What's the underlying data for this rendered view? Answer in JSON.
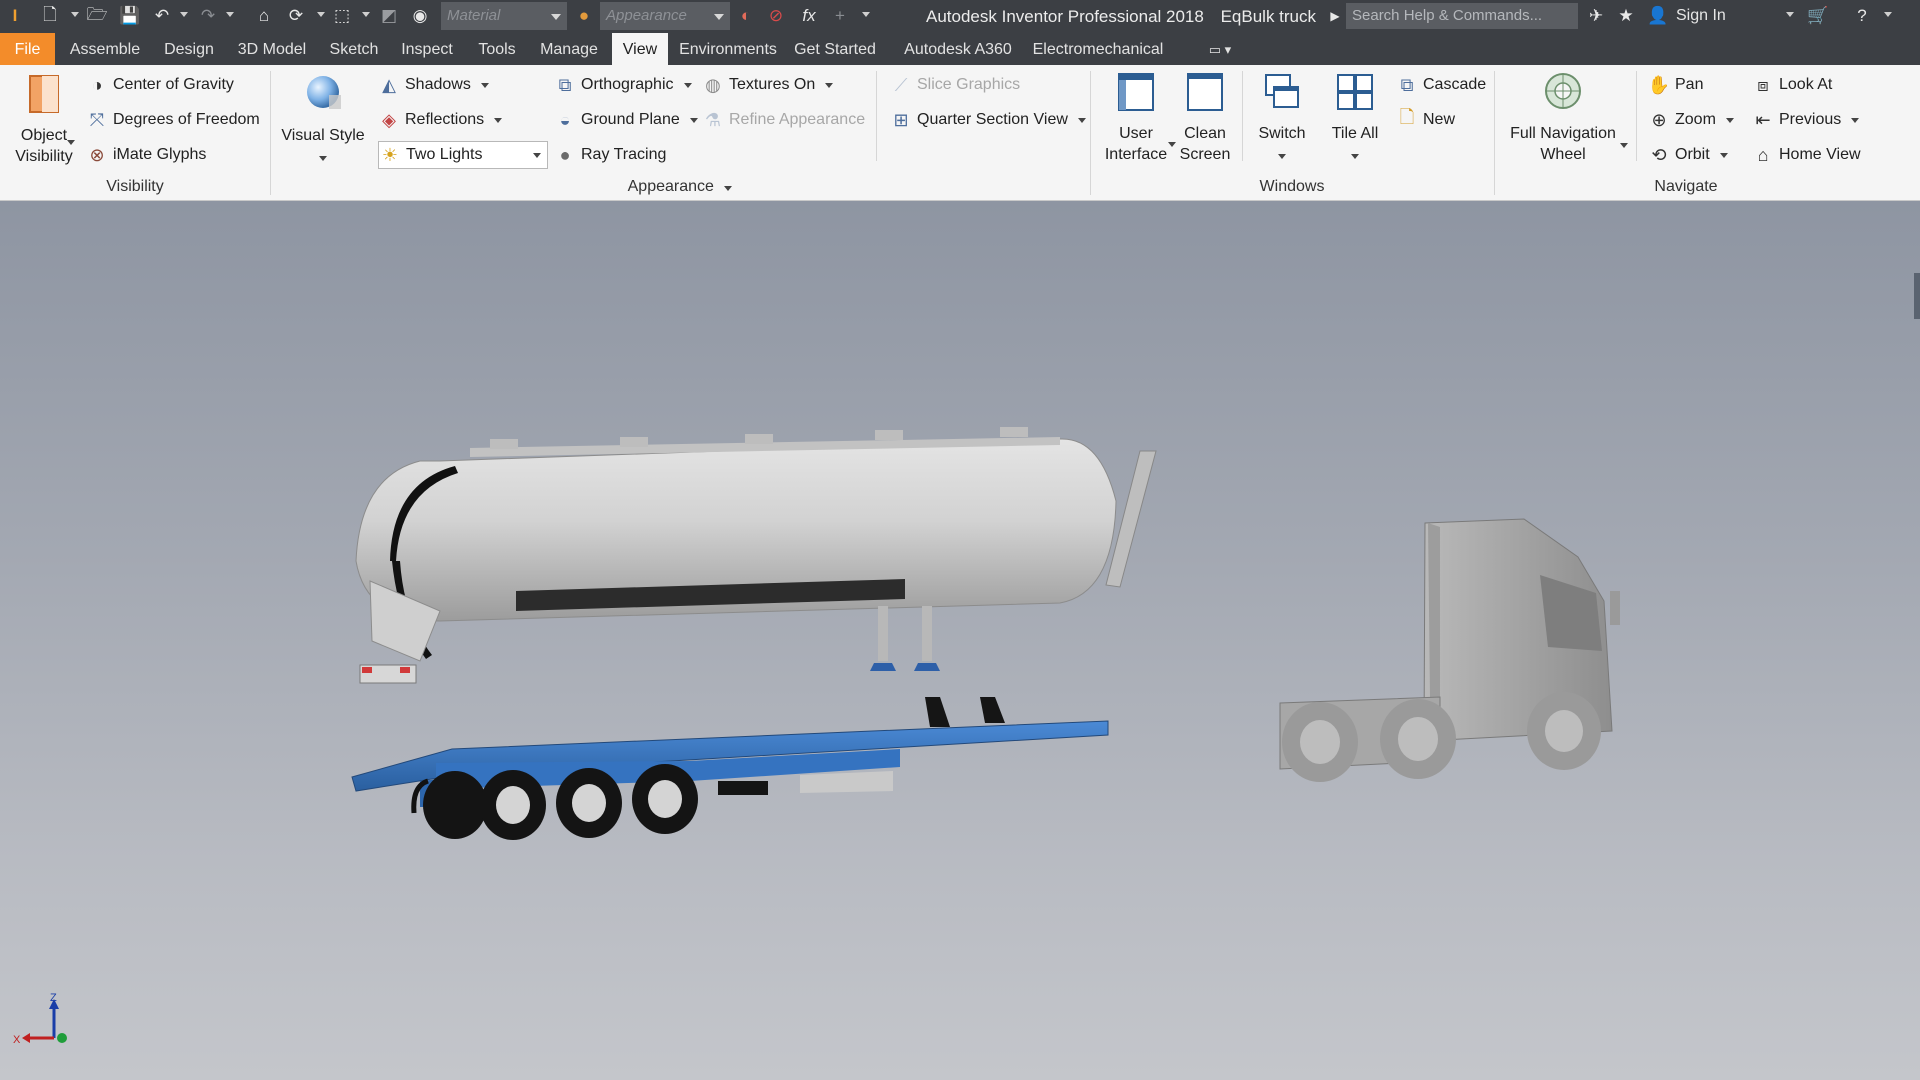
{
  "app": {
    "title": "Autodesk Inventor Professional 2018",
    "document": "EqBulk truck",
    "material_placeholder": "Material",
    "appearance_placeholder": "Appearance",
    "search_placeholder": "Search Help & Commands...",
    "sign_in": "Sign In"
  },
  "tabs": [
    {
      "label": "File"
    },
    {
      "label": "Assemble"
    },
    {
      "label": "Design"
    },
    {
      "label": "3D Model"
    },
    {
      "label": "Sketch"
    },
    {
      "label": "Inspect"
    },
    {
      "label": "Tools"
    },
    {
      "label": "Manage"
    },
    {
      "label": "View"
    },
    {
      "label": "Environments"
    },
    {
      "label": "Get Started"
    },
    {
      "label": "Autodesk A360"
    },
    {
      "label": "Electromechanical"
    }
  ],
  "visibility": {
    "object_visibility_1": "Object",
    "object_visibility_2": "Visibility",
    "center_of_gravity": "Center of Gravity",
    "degrees_of_freedom": "Degrees of Freedom",
    "imate_glyphs": "iMate Glyphs",
    "panel": "Visibility"
  },
  "appearance": {
    "visual_style": "Visual Style",
    "shadows": "Shadows",
    "reflections": "Reflections",
    "lighting": "Two Lights",
    "orthographic": "Orthographic",
    "ground_plane": "Ground Plane",
    "ray_tracing": "Ray Tracing",
    "textures_on": "Textures On",
    "refine_appearance": "Refine Appearance",
    "slice_graphics": "Slice Graphics",
    "quarter_section_view": "Quarter Section View",
    "panel": "Appearance"
  },
  "windows": {
    "user_interface_1": "User",
    "user_interface_2": "Interface",
    "clean_screen_1": "Clean",
    "clean_screen_2": "Screen",
    "switch": "Switch",
    "tile_all": "Tile All",
    "cascade": "Cascade",
    "new": "New",
    "panel": "Windows"
  },
  "navigate": {
    "full_nav_1": "Full Navigation",
    "full_nav_2": "Wheel",
    "pan": "Pan",
    "zoom": "Zoom",
    "orbit": "Orbit",
    "look_at": "Look At",
    "previous": "Previous",
    "home_view": "Home View",
    "panel": "Navigate"
  },
  "triad": {
    "z": "Z",
    "x": "X"
  }
}
